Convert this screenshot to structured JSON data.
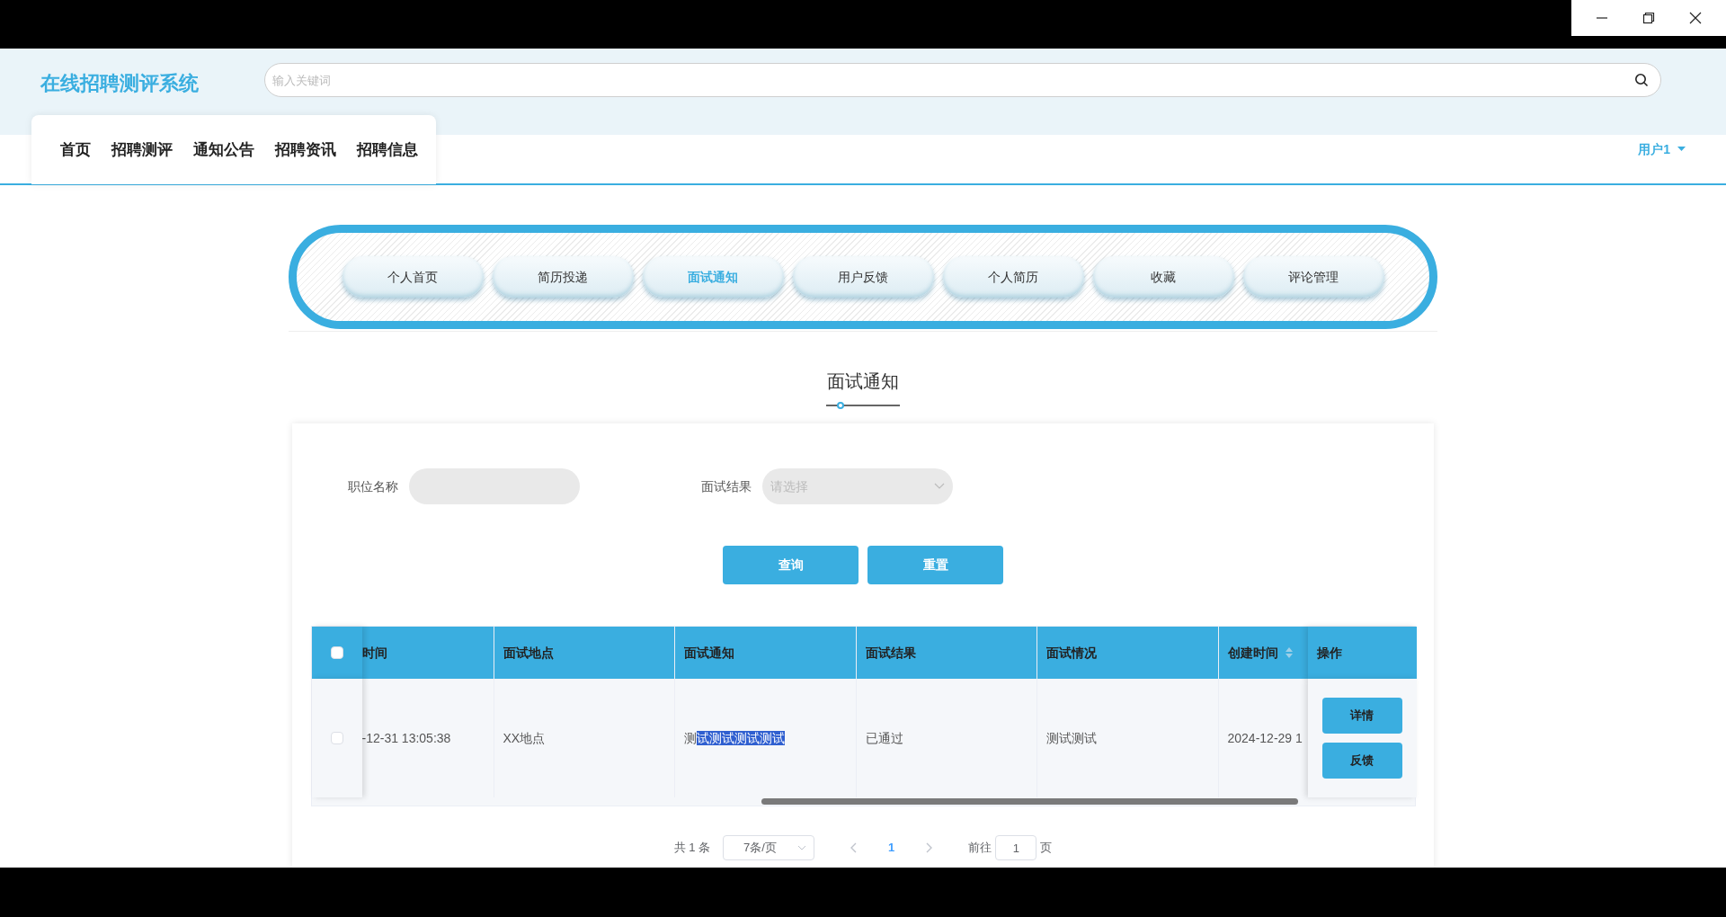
{
  "site": {
    "title": "在线招聘测评系统",
    "search_placeholder": "输入关键词"
  },
  "nav": [
    {
      "label": "首页"
    },
    {
      "label": "招聘测评"
    },
    {
      "label": "通知公告"
    },
    {
      "label": "招聘资讯"
    },
    {
      "label": "招聘信息"
    }
  ],
  "user": {
    "name": "用户1"
  },
  "center_tabs": [
    {
      "label": "个人首页",
      "selected": false
    },
    {
      "label": "简历投递",
      "selected": false
    },
    {
      "label": "面试通知",
      "selected": true
    },
    {
      "label": "用户反馈",
      "selected": false
    },
    {
      "label": "个人简历",
      "selected": false
    },
    {
      "label": "收藏",
      "selected": false
    },
    {
      "label": "评论管理",
      "selected": false
    }
  ],
  "page_title": "面试通知",
  "filters": [
    {
      "label": "职位名称",
      "kind": "input"
    },
    {
      "label": "面试结果",
      "kind": "select",
      "placeholder": "请选择"
    }
  ],
  "buttons": [
    "查询",
    "重置"
  ],
  "table": {
    "all_checked": false,
    "columns": [
      "时间",
      "面试地点",
      "面试通知",
      "面试结果",
      "面试情况",
      "创建时间",
      "操作"
    ],
    "rows": [
      {
        "checked": false,
        "cells": [
          {
            "text": "-12-31 13:05:38"
          },
          {
            "text": "XX地点"
          },
          {
            "text": "测",
            "selected_text": "试测试测试测试"
          },
          {
            "text": "已通过"
          },
          {
            "text": "测试测试"
          },
          {
            "text": "2024-12-29 1"
          }
        ],
        "actions": [
          "详情",
          "反馈"
        ]
      }
    ]
  },
  "pagination": {
    "total": "共 1 条",
    "page_size": "7条/页",
    "pages": [
      {
        "label": "1",
        "selected": true
      }
    ],
    "goto_label": "前往",
    "goto_value": "1",
    "goto_suffix": "页"
  }
}
